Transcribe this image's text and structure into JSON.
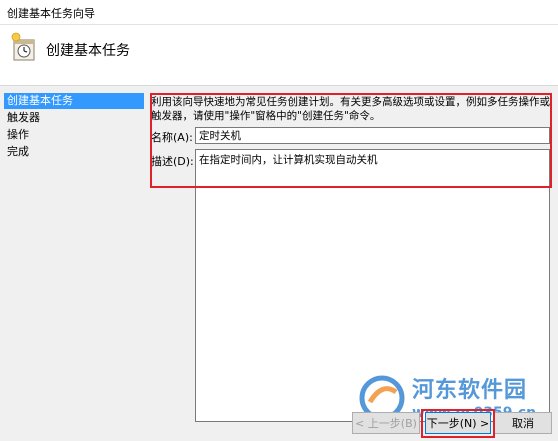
{
  "window": {
    "title": "创建基本任务向导"
  },
  "header": {
    "title": "创建基本任务",
    "icon": "task-scheduler-icon"
  },
  "sidebar": {
    "items": [
      {
        "label": "创建基本任务",
        "active": true
      },
      {
        "label": "触发器",
        "active": false
      },
      {
        "label": "操作",
        "active": false
      },
      {
        "label": "完成",
        "active": false
      }
    ]
  },
  "form": {
    "intro": "利用该向导快速地为常见任务创建计划。有关更多高级选项或设置，例如多任务操作或触发器，请使用\"操作\"窗格中的\"创建任务\"命令。",
    "name_label": "名称(A):",
    "name_value": "定时关机",
    "desc_label": "描述(D):",
    "desc_value": "在指定时间内，让计算机实现自动关机"
  },
  "buttons": {
    "back": "< 上一步(B)",
    "next": "下一步(N) >",
    "cancel": "取消"
  },
  "watermark": {
    "title": "河东软件园",
    "url": "www.pc0359.cn"
  },
  "colors": {
    "highlight": "#e0202a",
    "selection": "#3399ff"
  }
}
